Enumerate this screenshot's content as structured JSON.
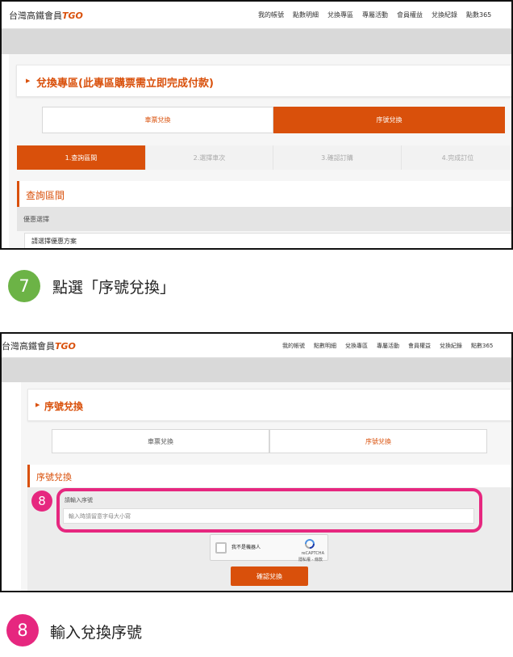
{
  "colors": {
    "accent": "#d9500b",
    "highlight": "#e6277f",
    "step7_badge": "#6cb346",
    "step8_badge": "#e6277f"
  },
  "screenshot1": {
    "logo_text": "台灣高鐵會員",
    "logo_brand": "TGO",
    "nav": [
      "我的帳號",
      "點數明細",
      "兌換專區",
      "專屬活動",
      "會員權益",
      "兌換紀錄",
      "點數365"
    ],
    "page_title": "兌換專區(此專區購票需立即完成付款)",
    "tabs": [
      "車票兌換",
      "序號兌換"
    ],
    "steps": [
      "1.查詢區間",
      "2.選擇車次",
      "3.確認訂購",
      "4.完成訂位"
    ],
    "section_title": "查詢區間",
    "subheader": "優惠選擇",
    "select_value": "請選擇優惠方案"
  },
  "caption7": {
    "number": "7",
    "text": "點選「序號兌換」"
  },
  "screenshot2": {
    "logo_text": "台灣高鐵會員",
    "logo_brand": "TGO",
    "nav": [
      "我的帳號",
      "點數明細",
      "兌換專區",
      "專屬活動",
      "會員權益",
      "兌換紀錄",
      "點數365"
    ],
    "page_title": "序號兌換",
    "tabs": [
      "車票兌換",
      "序號兌換"
    ],
    "section_title": "序號兌換",
    "input_label": "請輸入序號",
    "input_placeholder": "輸入時請留意字母大小寫",
    "badge": "8",
    "captcha_label": "我不是機器人",
    "captcha_brand": "reCAPTCHA",
    "captcha_terms": "隱私權 - 條款",
    "confirm_button": "確認兌換"
  },
  "caption8": {
    "number": "8",
    "text": "輸入兌換序號"
  }
}
